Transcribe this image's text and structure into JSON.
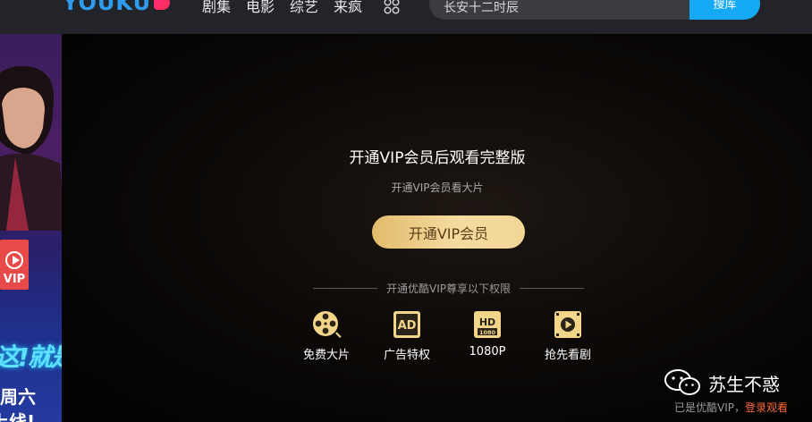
{
  "header": {
    "logo_text": "YOUKU",
    "nav": [
      {
        "label": "剧集"
      },
      {
        "label": "电影"
      },
      {
        "label": "综艺"
      },
      {
        "label": "来疯"
      }
    ],
    "more_icon": "grid-circles-icon",
    "search": {
      "value": "长安十二时辰",
      "button_label": "搜库"
    },
    "accent": "#16a9f5"
  },
  "banner": {
    "vip_badge": "VIP",
    "title": "这!就是街舞",
    "day": "周六",
    "online": "上线!"
  },
  "paywall": {
    "title": "开通VIP会员后观看完整版",
    "subtitle": "开通VIP会员看大片",
    "cta_label": "开通VIP会员",
    "cta_color": "#f5dba0",
    "privileges_label": "开通优酷VIP尊享以下权限",
    "perks": [
      {
        "label": "免费大片",
        "icon": "film-reel-icon"
      },
      {
        "label": "广告特权",
        "icon": "ad-free-icon"
      },
      {
        "label": "1080P",
        "icon": "hd-1080-icon"
      },
      {
        "label": "抢先看剧",
        "icon": "play-film-icon"
      }
    ]
  },
  "watermark": {
    "text": "苏生不惑",
    "icon": "wechat-icon"
  },
  "login_prompt": {
    "text": "已是优酷VIP，",
    "link": "登录观看"
  }
}
